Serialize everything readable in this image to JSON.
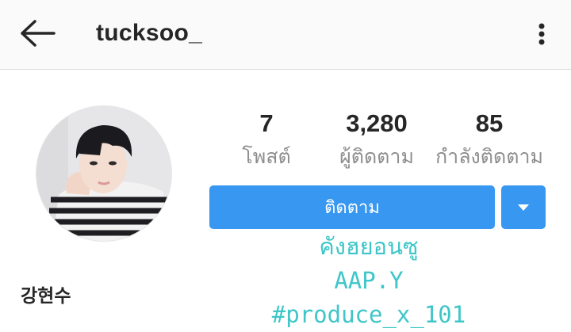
{
  "header": {
    "username": "tucksoo_",
    "back_icon": "arrow-left-icon",
    "more_icon": "more-vertical-icon"
  },
  "profile": {
    "full_name": "강현수",
    "avatar": "profile-photo",
    "stats": [
      {
        "value": "7",
        "label": "โพสต์"
      },
      {
        "value": "3,280",
        "label": "ผู้ติดตาม"
      },
      {
        "value": "85",
        "label": "กำลังติดตาม"
      }
    ],
    "follow_label": "ติดตาม",
    "dropdown_icon": "triangle-down-icon",
    "bio_lines": [
      "คังฮยอนซู",
      "AAP.Y",
      "#produce_x_101"
    ]
  },
  "colors": {
    "accent": "#3897f0",
    "bio_text": "#3ec6c9",
    "primary_text": "#262626",
    "secondary_text": "#8e8e8e"
  }
}
